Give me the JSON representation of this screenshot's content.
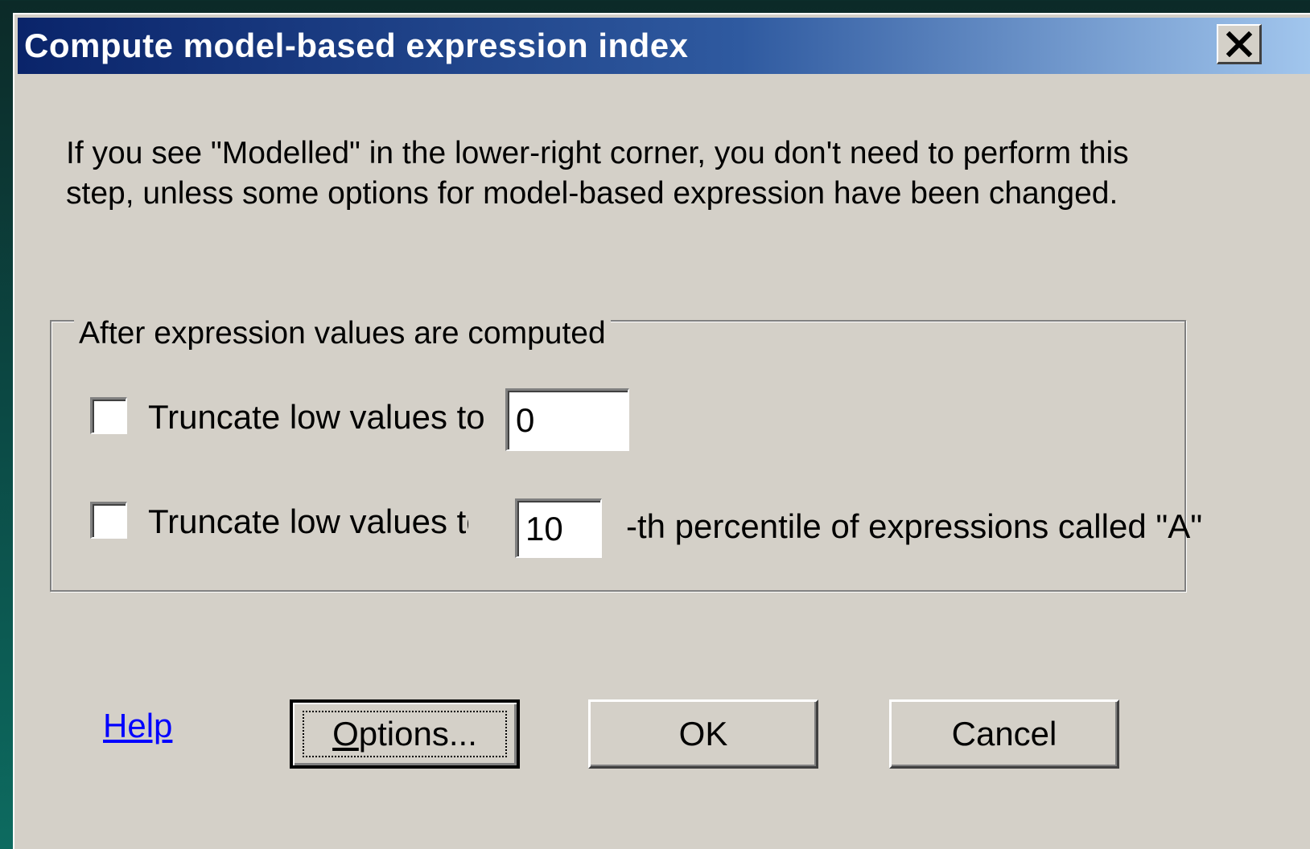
{
  "dialog": {
    "title": "Compute model-based expression index",
    "close_icon": "close-icon"
  },
  "intro_text": "If you see \"Modelled\" in the lower-right corner, you don't need to perform this step, unless some options for model-based expression have been changed.",
  "group": {
    "legend": "After expression values are computed",
    "row1": {
      "checked": false,
      "label": "Truncate low values to",
      "value": "0"
    },
    "row2": {
      "checked": false,
      "label": "Truncate low values to",
      "value": "10",
      "suffix": "-th percentile of expressions called \"A\""
    }
  },
  "footer": {
    "help_label": "Help",
    "options_mnemonic": "O",
    "options_rest": "ptions...",
    "ok_label": "OK",
    "cancel_label": "Cancel"
  }
}
